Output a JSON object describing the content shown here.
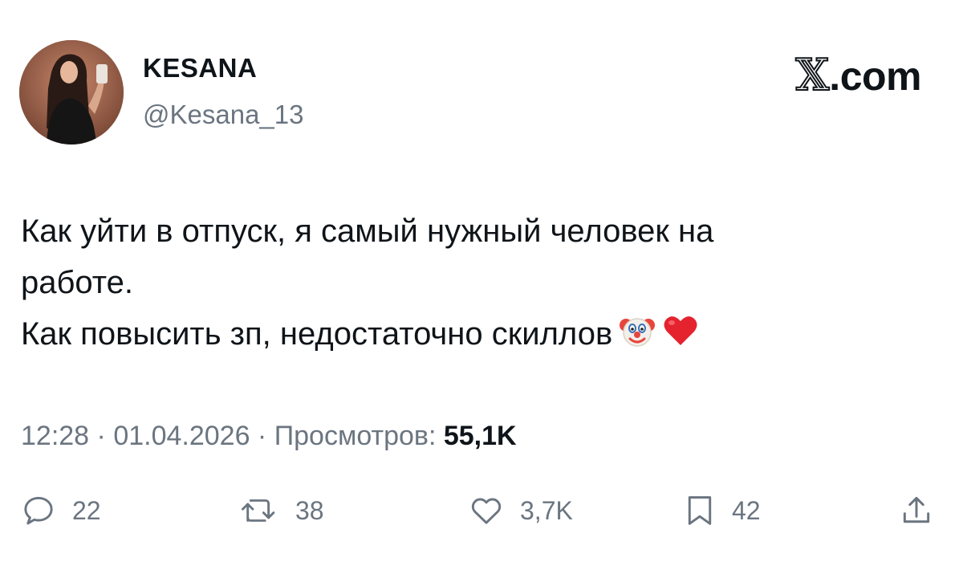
{
  "author": {
    "display_name": "KESANA",
    "handle": "@Kesana_13",
    "avatar_icon": "profile-photo"
  },
  "brand": {
    "x_glyph": "𝕏",
    "suffix": ".com"
  },
  "tweet": {
    "lines": [
      "Как уйти в отпуск, я самый нужный человек на",
      "работе.",
      "Как повысить зп, недостаточно скиллов"
    ],
    "emojis": [
      "clown-face",
      "red-heart"
    ]
  },
  "meta": {
    "time": "12:28",
    "separator": " · ",
    "date": "01.04.2026",
    "views_label": "Просмотров:",
    "views_count": "55,1K"
  },
  "actions": {
    "replies": "22",
    "reposts": "38",
    "likes": "3,7K",
    "bookmarks": "42"
  },
  "colors": {
    "text": "#0f1419",
    "secondary": "#6b7580"
  }
}
